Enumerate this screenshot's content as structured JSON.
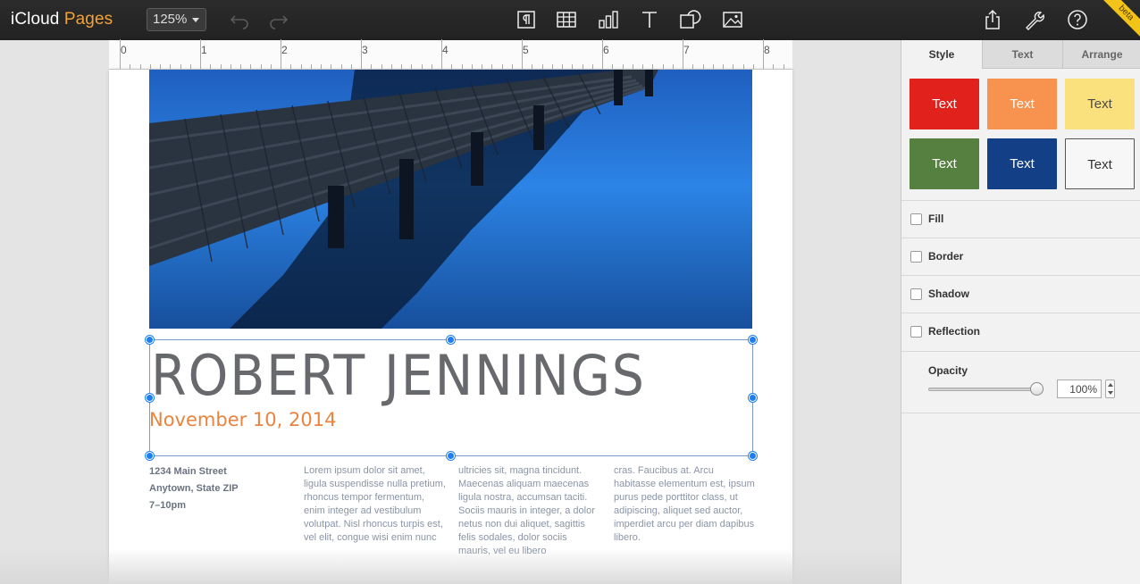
{
  "topbar": {
    "brand_prefix": "iCloud",
    "brand_app": "Pages",
    "zoom_value": "125%",
    "beta_label": "beta",
    "icons": [
      "undo-icon",
      "redo-icon",
      "paragraph-icon",
      "table-icon",
      "chart-icon",
      "text-icon",
      "shape-icon",
      "image-icon",
      "share-icon",
      "wrench-icon",
      "help-icon"
    ]
  },
  "ruler": {
    "labels": [
      "0",
      "1",
      "2",
      "3",
      "4",
      "5",
      "6",
      "7",
      "8"
    ]
  },
  "document": {
    "headline": "ROBERT JENNINGS",
    "date": "November 10, 2014",
    "address": [
      "1234 Main Street",
      "Anytown, State ZIP",
      "7–10pm"
    ],
    "columns": [
      "Lorem ipsum dolor sit amet, ligula suspendisse nulla pretium, rhoncus tempor fermentum, enim integer ad vestibulum volutpat. Nisl rhoncus turpis est, vel elit, congue wisi enim nunc",
      "ultricies sit, magna tincidunt. Maecenas aliquam maecenas ligula nostra, accumsan taciti. Sociis mauris in integer, a dolor netus non dui aliquet, sagittis felis sodales, dolor sociis mauris, vel eu libero",
      "cras. Faucibus at. Arcu habitasse elementum est, ipsum purus pede porttitor class, ut adipiscing, aliquet sed auctor, imperdiet arcu per diam dapibus libero."
    ],
    "colors": {
      "date": "#e8843f",
      "headline": "#4e5054",
      "selection": "#1c7ef0"
    }
  },
  "inspector": {
    "tabs": [
      "Style",
      "Text",
      "Arrange"
    ],
    "active_tab": "Style",
    "swatches": [
      {
        "label": "Text",
        "bg": "#e0211c",
        "fg": "#ffffff"
      },
      {
        "label": "Text",
        "bg": "#f7924f",
        "fg": "#ffffff"
      },
      {
        "label": "Text",
        "bg": "#fbe07e",
        "fg": "#4a4a4a"
      },
      {
        "label": "Text",
        "bg": "#568040",
        "fg": "#ffffff"
      },
      {
        "label": "Text",
        "bg": "#123f86",
        "fg": "#ffffff"
      },
      {
        "label": "Text",
        "bg": "#f7f7f7",
        "fg": "#333333"
      }
    ],
    "options": [
      "Fill",
      "Border",
      "Shadow",
      "Reflection"
    ],
    "opacity_label": "Opacity",
    "opacity_value": "100%",
    "opacity_level": 1.0
  }
}
